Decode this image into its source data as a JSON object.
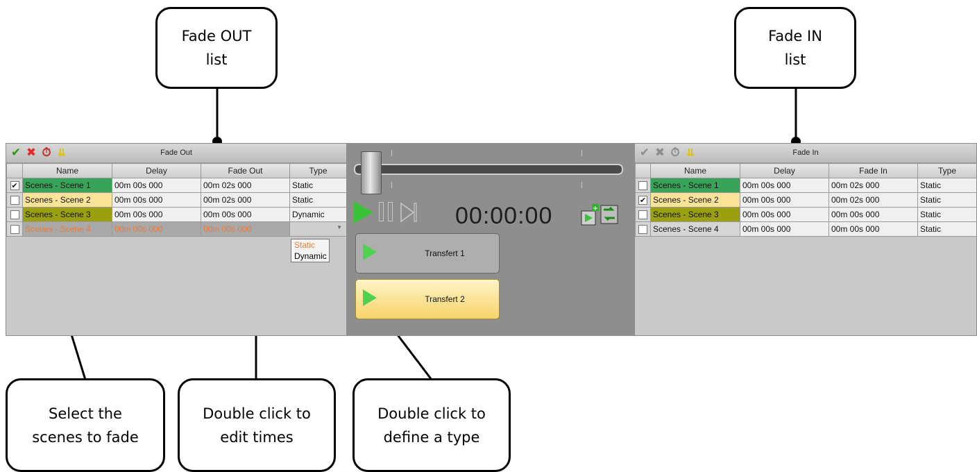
{
  "callouts": {
    "fade_out_list": "Fade OUT\nlist",
    "fade_in_list": "Fade IN\nlist",
    "select_scenes": "Select the\nscenes to fade",
    "edit_times": "Double click to\nedit times",
    "define_type": "Double click to\ndefine a type"
  },
  "fade_out": {
    "title": "Fade Out",
    "columns": [
      "Name",
      "Delay",
      "Fade Out",
      "Type"
    ],
    "rows": [
      {
        "checked": true,
        "name": "Scenes - Scene 1",
        "delay": "00m 00s 000",
        "fade": "00m 02s 000",
        "type": "Static",
        "color": "#3aa35a"
      },
      {
        "checked": false,
        "name": "Scenes - Scene 2",
        "delay": "00m 00s 000",
        "fade": "00m 02s 000",
        "type": "Static",
        "color": "#fbe39a"
      },
      {
        "checked": false,
        "name": "Scenes - Scene 3",
        "delay": "00m 00s 000",
        "fade": "00m 00s 000",
        "type": "Dynamic",
        "color": "#9aa010"
      },
      {
        "checked": false,
        "name": "Scenes - Scene 4",
        "delay": "00m 00s 000",
        "fade": "00m 00s 000",
        "type": "",
        "color": "#a9a9a9"
      }
    ],
    "type_options": [
      "Static",
      "Dynamic"
    ]
  },
  "fade_in": {
    "title": "Fade In",
    "columns": [
      "Name",
      "Delay",
      "Fade In",
      "Type"
    ],
    "rows": [
      {
        "checked": false,
        "name": "Scenes - Scene 1",
        "delay": "00m 00s 000",
        "fade": "00m 02s 000",
        "type": "Static",
        "color": "#3aa35a"
      },
      {
        "checked": true,
        "name": "Scenes - Scene 2",
        "delay": "00m 00s 000",
        "fade": "00m 02s 000",
        "type": "Static",
        "color": "#fbe39a"
      },
      {
        "checked": false,
        "name": "Scenes - Scene 3",
        "delay": "00m 00s 000",
        "fade": "00m 00s 000",
        "type": "Static",
        "color": "#9aa010"
      },
      {
        "checked": false,
        "name": "Scenes - Scene 4",
        "delay": "00m 00s 000",
        "fade": "00m 00s 000",
        "type": "Static",
        "color": "#d6d6d6"
      }
    ]
  },
  "player": {
    "time": "00:00:00",
    "transfers": [
      "Transfert 1",
      "Transfert 2"
    ],
    "active_transfer": 1
  },
  "icons": [
    "check-icon",
    "delete-icon",
    "timer-icon",
    "arrows-down-icon",
    "play-icon",
    "pause-icon",
    "next-icon",
    "add-transfer-icon",
    "swap-icon"
  ]
}
